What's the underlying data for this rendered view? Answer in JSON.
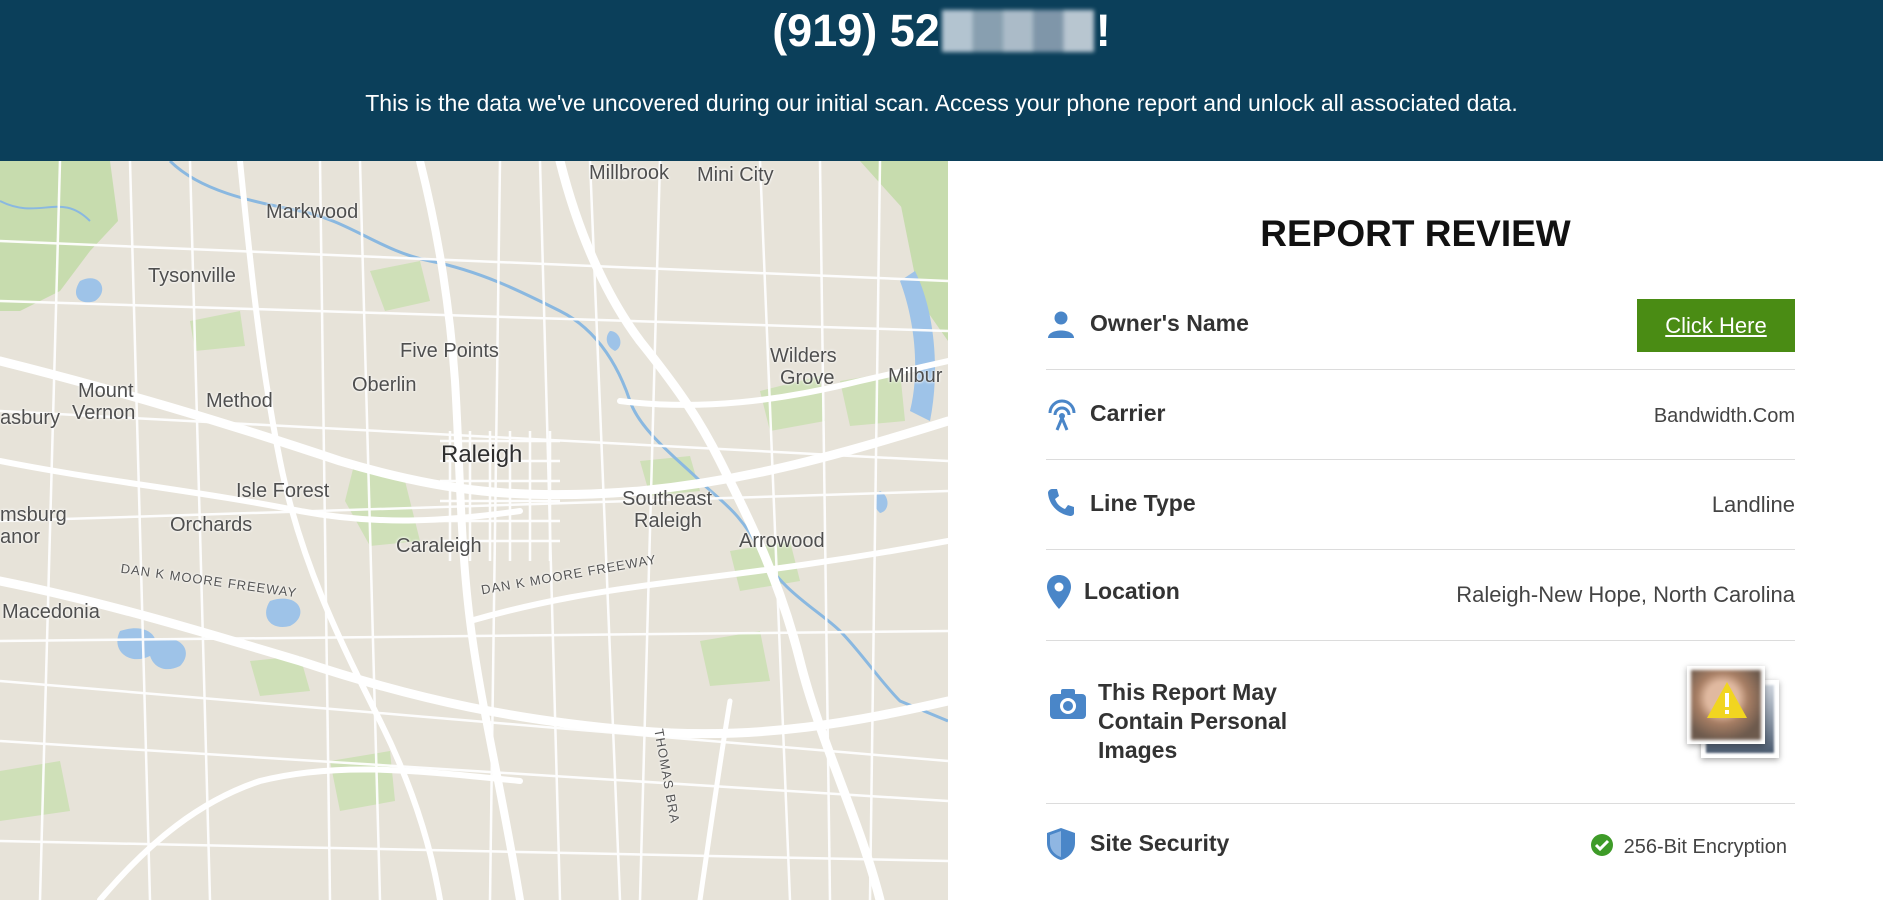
{
  "header": {
    "phone_prefix": "(919) 52",
    "phone_suffix": "!",
    "subtitle": "This is the data we've uncovered during our initial scan. Access your phone report and unlock all associated data."
  },
  "map": {
    "labels": [
      {
        "text": "Millbrook"
      },
      {
        "text": "Mini City"
      },
      {
        "text": "Markwood"
      },
      {
        "text": "Tysonville"
      },
      {
        "text": "Five Points"
      },
      {
        "text": "Wilders"
      },
      {
        "text": "Grove"
      },
      {
        "text": "Milbur"
      },
      {
        "text": "Mount"
      },
      {
        "text": "Vernon"
      },
      {
        "text": "Oberlin"
      },
      {
        "text": "Method"
      },
      {
        "text": "asbury"
      },
      {
        "text": "Raleigh"
      },
      {
        "text": "Isle Forest"
      },
      {
        "text": "Southeast"
      },
      {
        "text": "Raleigh"
      },
      {
        "text": "msburg"
      },
      {
        "text": "anor"
      },
      {
        "text": "Orchards"
      },
      {
        "text": "Caraleigh"
      },
      {
        "text": "Arrowood"
      },
      {
        "text": "DAN K MOORE FREEWAY"
      },
      {
        "text": "DAN K MOORE FREEWAY"
      },
      {
        "text": "Macedonia"
      },
      {
        "text": "THOMAS BRA"
      }
    ]
  },
  "report": {
    "title": "REPORT REVIEW",
    "rows": [
      {
        "icon": "person-icon",
        "label": "Owner's Name",
        "action": "Click Here"
      },
      {
        "icon": "antenna-icon",
        "label": "Carrier",
        "value": "Bandwidth.Com"
      },
      {
        "icon": "phone-icon",
        "label": "Line Type",
        "value": "Landline"
      },
      {
        "icon": "map-pin-icon",
        "label": "Location",
        "value": "Raleigh-New Hope, North Carolina"
      },
      {
        "icon": "camera-icon",
        "label_lines": [
          "This Report May",
          "Contain Personal",
          "Images"
        ]
      },
      {
        "icon": "shield-icon",
        "label": "Site Security",
        "value": "256-Bit Encryption"
      }
    ]
  },
  "colors": {
    "header_bg": "#0b3f5a",
    "icon_blue": "#4a86c8",
    "cta_green": "#4a8c14",
    "check_green": "#3e9b28"
  }
}
